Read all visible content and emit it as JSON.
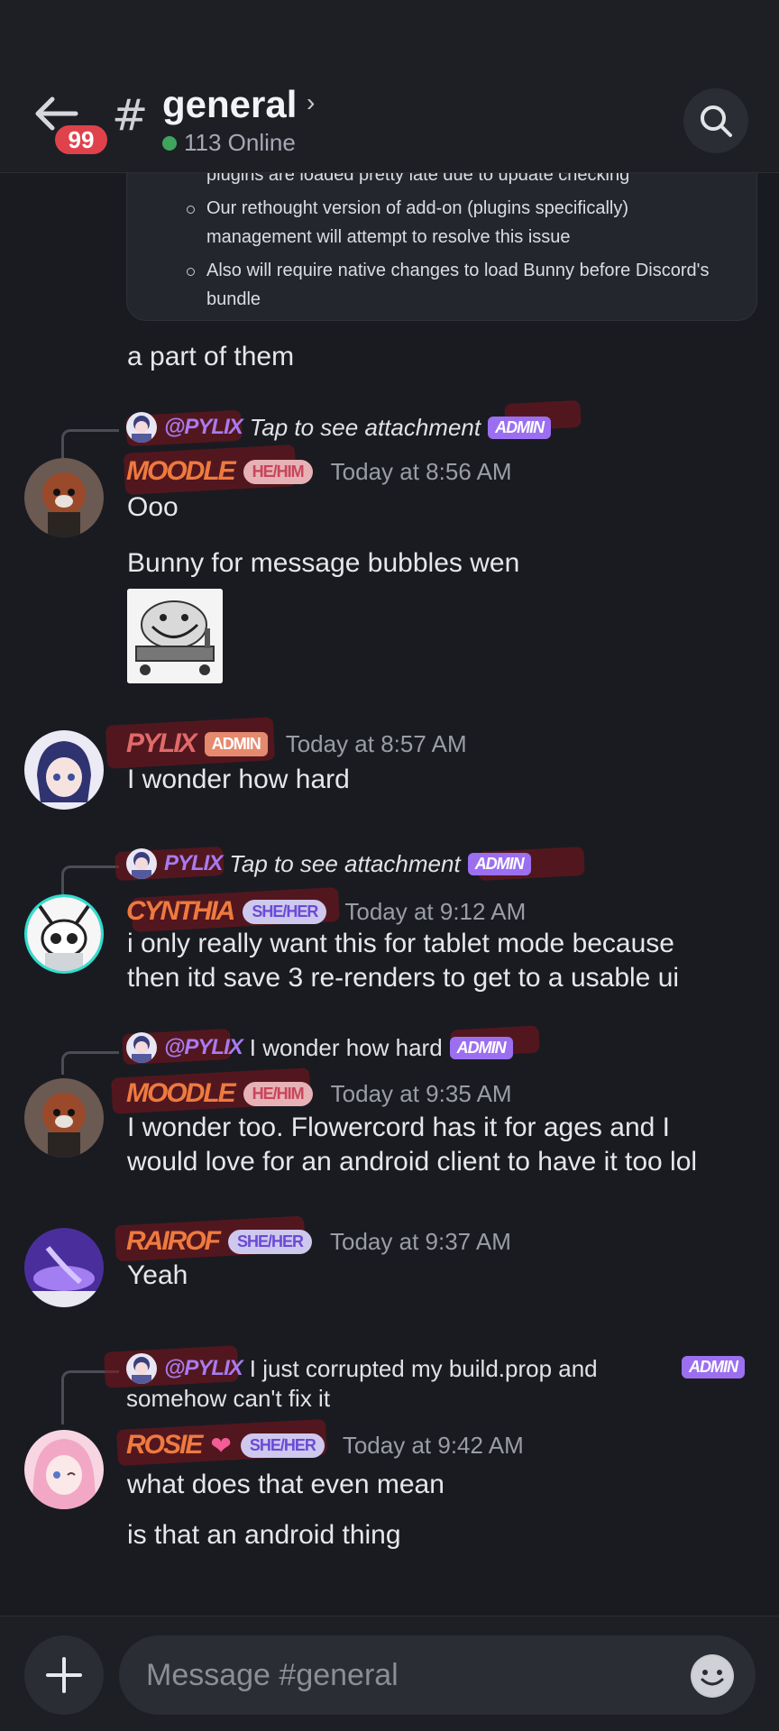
{
  "header": {
    "unread_count": "99",
    "channel_hash": "#",
    "channel_name": "general",
    "chevron": "›",
    "online_text": "113 Online"
  },
  "embed": {
    "items": [
      "plugins are loaded pretty late due to update checking",
      "Our rethought version of add-on (plugins specifically) management will attempt to resolve this issue",
      "Also will require native changes to load Bunny before Discord's bundle"
    ]
  },
  "messages": [
    {
      "text": "a part of them"
    },
    {
      "reply": {
        "name": "@PYLIX",
        "text": "Tap to see attachment",
        "badge": "ADMIN"
      },
      "author": "MOODLE",
      "pronoun": "HE/HIM",
      "time": "Today at 8:56 AM",
      "lines": [
        "Ooo",
        "Bunny for message bubbles wen"
      ]
    },
    {
      "author": "PYLIX",
      "badge": "ADMIN",
      "time": "Today at 8:57 AM",
      "lines": [
        "I wonder how hard"
      ]
    },
    {
      "reply": {
        "name": "PYLIX",
        "text": "Tap to see attachment",
        "badge": "ADMIN"
      },
      "author": "CYNTHIA",
      "pronoun": "SHE/HER",
      "time": "Today at 9:12 AM",
      "lines": [
        "i only really want this for tablet mode because",
        "then itd save 3 re-renders to get to a usable ui"
      ]
    },
    {
      "reply": {
        "name": "@PYLIX",
        "text": "I wonder how hard",
        "badge": "ADMIN"
      },
      "author": "MOODLE",
      "pronoun": "HE/HIM",
      "time": "Today at 9:35 AM",
      "lines": [
        "I wonder too. Flowercord has it for ages and I",
        "would love for an android client to have it too lol"
      ]
    },
    {
      "author": "RAIROF",
      "pronoun": "SHE/HER",
      "time": "Today at 9:37 AM",
      "lines": [
        "Yeah"
      ]
    },
    {
      "reply": {
        "name": "@PYLIX",
        "text": "I just corrupted my build.prop and",
        "text2": "somehow can't fix it",
        "badge": "ADMIN"
      },
      "author": "ROSIE",
      "pronoun": "SHE/HER",
      "time": "Today at 9:42 AM",
      "lines": [
        "what does that even mean",
        "is that an android thing"
      ]
    }
  ],
  "composer": {
    "placeholder": "Message #general"
  },
  "colors": {
    "accent": "#a77bf0",
    "author_orange": "#ee7a3f",
    "online": "#3fa45d",
    "badge_red": "#e0424b"
  }
}
